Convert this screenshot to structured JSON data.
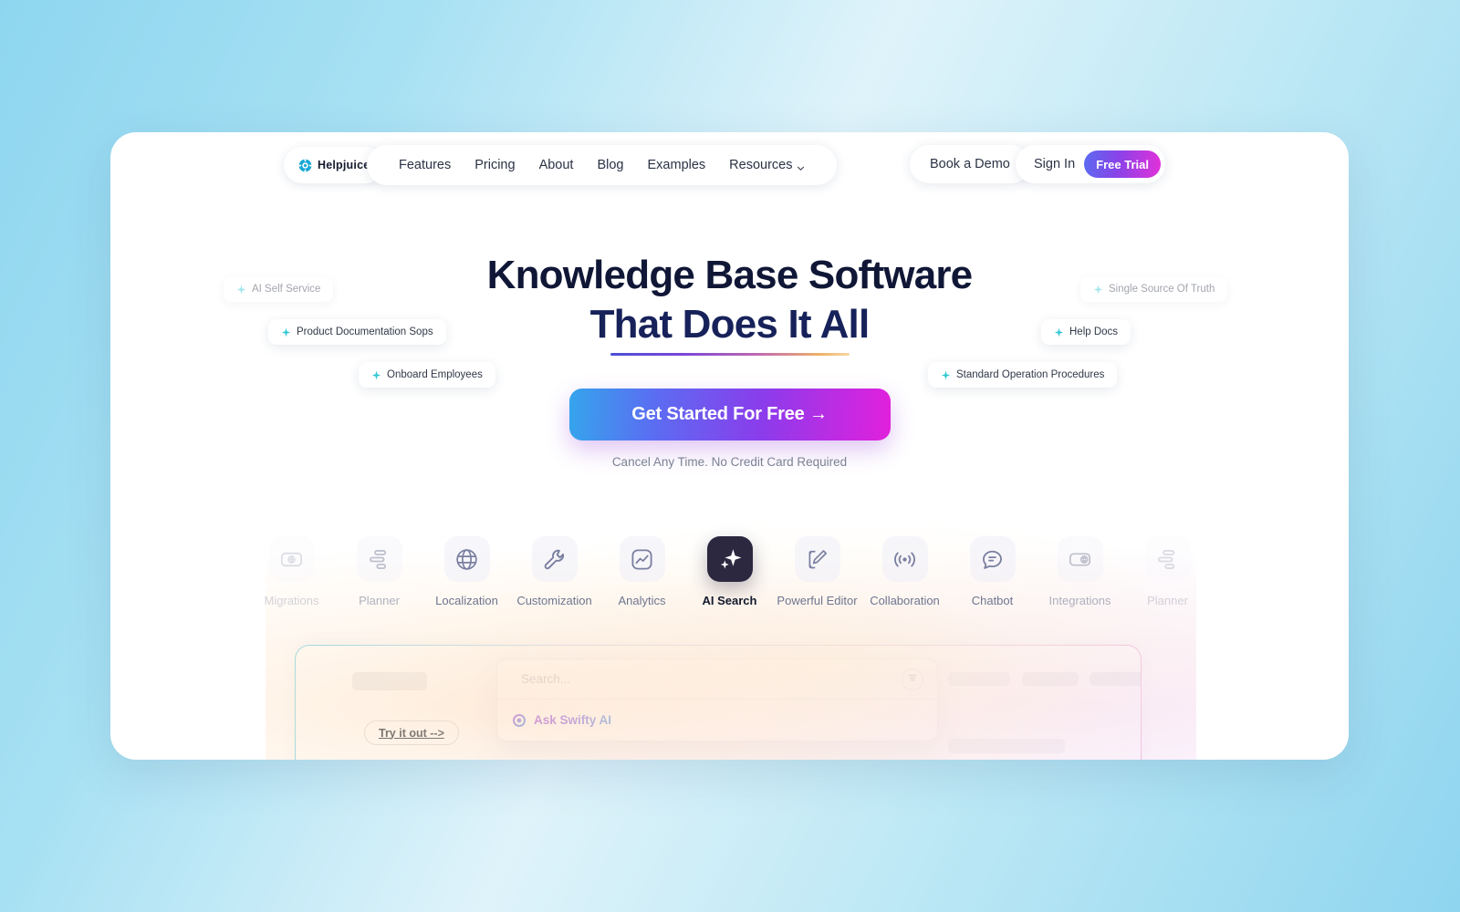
{
  "brand": {
    "name": "Helpjuice",
    "logo_icon": "helpjuice-logo-icon"
  },
  "nav": {
    "links": [
      {
        "label": "Features",
        "icon": null
      },
      {
        "label": "Pricing",
        "icon": null
      },
      {
        "label": "About",
        "icon": null
      },
      {
        "label": "Blog",
        "icon": null
      },
      {
        "label": "Examples",
        "icon": null
      },
      {
        "label": "Resources",
        "icon": "chevron-down-icon"
      }
    ],
    "book_demo": "Book a Demo",
    "sign_in": "Sign In",
    "free_trial": "Free Trial",
    "free_trial_gradient": [
      "#5b6bf0",
      "#8a42e8",
      "#e331d9"
    ]
  },
  "hero": {
    "headline_line1": "Knowledge Base Software",
    "headline_line2": "That Does It All",
    "headline_color": "#101736",
    "underline_gradient": [
      "#4b4fd6",
      "#7a46d8",
      "#c06ab0",
      "#f0b36a"
    ],
    "cta_label": "Get Started For Free →",
    "cta_gradient": [
      "#35a5ec",
      "#5a6ef2",
      "#8b3ceb",
      "#e220dc"
    ],
    "cta_note": "Cancel Any Time. No Credit Card Required"
  },
  "tags": [
    {
      "label": "AI Self Service",
      "icon": "sparkle-icon",
      "faded": true
    },
    {
      "label": "Product Documentation Sops",
      "icon": "sparkle-icon",
      "faded": false
    },
    {
      "label": "Onboard Employees",
      "icon": "sparkle-icon",
      "faded": false
    },
    {
      "label": "Single Source Of Truth",
      "icon": "sparkle-icon",
      "faded": true
    },
    {
      "label": "Help Docs",
      "icon": "sparkle-icon",
      "faded": false
    },
    {
      "label": "Standard Operation Procedures",
      "icon": "sparkle-icon",
      "faded": false
    }
  ],
  "features": [
    {
      "label": "Migrations",
      "icon": "migrations-icon",
      "active": false,
      "dim": 1
    },
    {
      "label": "Planner",
      "icon": "planner-icon",
      "active": false,
      "dim": 2
    },
    {
      "label": "Localization",
      "icon": "globe-icon",
      "active": false,
      "dim": 0
    },
    {
      "label": "Customization",
      "icon": "wrench-icon",
      "active": false,
      "dim": 0
    },
    {
      "label": "Analytics",
      "icon": "analytics-icon",
      "active": false,
      "dim": 0
    },
    {
      "label": "AI Search",
      "icon": "sparkles-icon",
      "active": true,
      "dim": 0
    },
    {
      "label": "Powerful Editor",
      "icon": "editor-pen-icon",
      "active": false,
      "dim": 0
    },
    {
      "label": "Collaboration",
      "icon": "broadcast-icon",
      "active": false,
      "dim": 0
    },
    {
      "label": "Chatbot",
      "icon": "chat-bubble-icon",
      "active": false,
      "dim": 0
    },
    {
      "label": "Integrations",
      "icon": "integrations-icon",
      "active": false,
      "dim": 2
    },
    {
      "label": "Planner",
      "icon": "planner-icon",
      "active": false,
      "dim": 1
    }
  ],
  "app_panel": {
    "try_it_out": "Try it out -->",
    "search": {
      "placeholder": "Search...",
      "value": "",
      "search_icon": "magnifier-icon",
      "filter_icon": "filter-icon"
    },
    "ask_ai": {
      "label": "Ask Swifty AI",
      "icon": "ai-orb-icon",
      "gradient": [
        "#8b2fe0",
        "#2f7fe8"
      ]
    },
    "border_gradient": [
      "#7fd7e8",
      "#c9d3f0",
      "#dcc3e8",
      "#eeaed6"
    ]
  }
}
